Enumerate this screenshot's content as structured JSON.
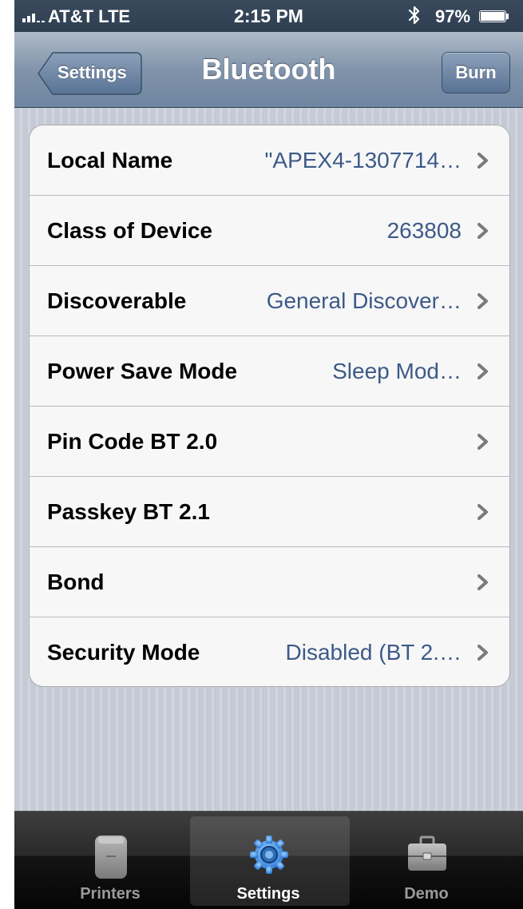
{
  "status_bar": {
    "carrier": "AT&T  LTE",
    "time": "2:15 PM",
    "battery": "97%",
    "battery_level": 0.97
  },
  "nav": {
    "back_label": "Settings",
    "title": "Bluetooth",
    "burn_label": "Burn"
  },
  "cells": [
    {
      "label": "Local Name",
      "value": "\"APEX4-1307714…"
    },
    {
      "label": "Class of Device",
      "value": "263808"
    },
    {
      "label": "Discoverable",
      "value": "General Discover…"
    },
    {
      "label": "Power Save Mode",
      "value": "Sleep Mod…"
    },
    {
      "label": "Pin Code BT 2.0",
      "value": ""
    },
    {
      "label": "Passkey BT 2.1",
      "value": ""
    },
    {
      "label": "Bond",
      "value": ""
    },
    {
      "label": "Security Mode",
      "value": "Disabled (BT 2.…"
    }
  ],
  "tabs": [
    {
      "label": "Printers",
      "icon": "printer-icon",
      "selected": false
    },
    {
      "label": "Settings",
      "icon": "gear-icon",
      "selected": true
    },
    {
      "label": "Demo",
      "icon": "briefcase-icon",
      "selected": false
    }
  ],
  "colors": {
    "nav_bar": "#8194ab",
    "detail_text": "#3d5a88",
    "table_background": "#c7ccd6"
  }
}
